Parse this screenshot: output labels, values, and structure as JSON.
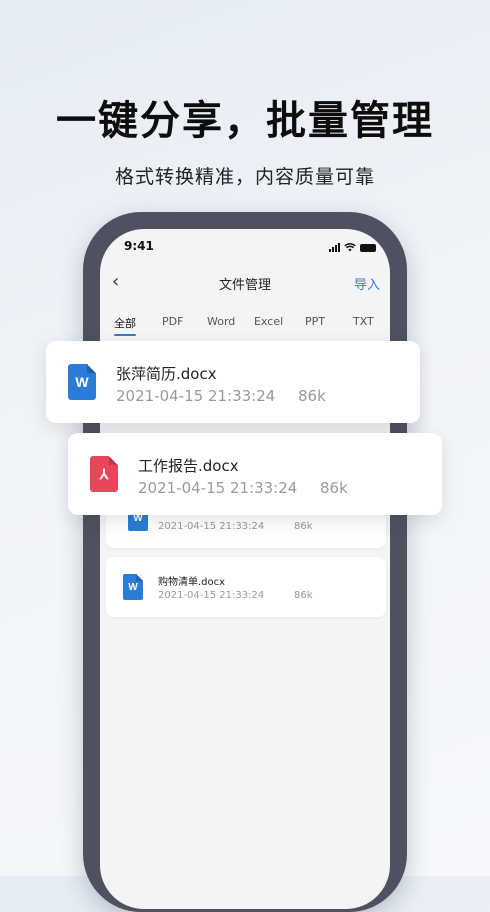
{
  "hero": {
    "title": "一键分享，批量管理",
    "subtitle": "格式转换精准，内容质量可靠"
  },
  "status_bar": {
    "time": "9:41"
  },
  "navbar": {
    "back_glyph": "‹",
    "title": "文件管理",
    "action": "导入"
  },
  "tabs": [
    "全部",
    "PDF",
    "Word",
    "Excel",
    "PPT",
    "TXT"
  ],
  "active_tab": "全部",
  "files": [
    {
      "name": "张萍简历.docx",
      "date": "2021-04-15 21:33:24",
      "size": "86k",
      "type": "word",
      "icon_label": "W"
    },
    {
      "name": "工作报告.docx",
      "date": "2021-04-15 21:33:24",
      "size": "86k",
      "type": "pdf",
      "icon_label": "⅄"
    },
    {
      "name": "",
      "date": "2021-04-15 21:33:24",
      "size": "86k",
      "type": "word",
      "icon_label": "W"
    },
    {
      "name": "购物清单.docx",
      "date": "2021-04-15 21:33:24",
      "size": "86k",
      "type": "word",
      "icon_label": "W"
    }
  ],
  "colors": {
    "accent": "#3b74d9",
    "word": "#2b7cd8",
    "pdf": "#e8475a",
    "phone_frame": "#4e5160"
  }
}
